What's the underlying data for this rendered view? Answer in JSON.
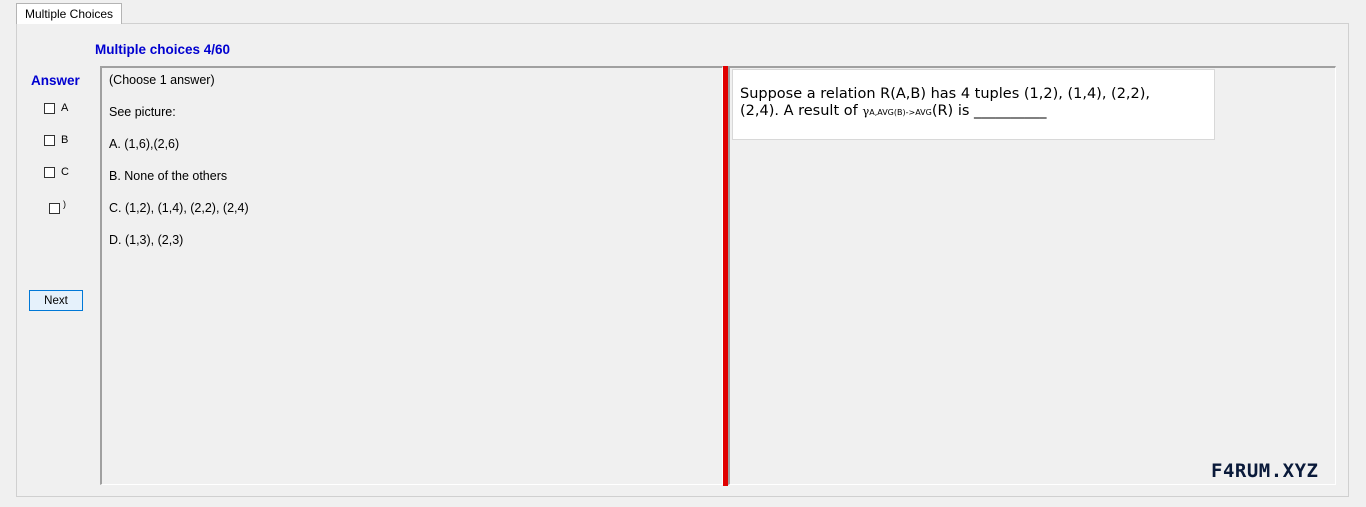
{
  "tab": {
    "label": "Multiple Choices"
  },
  "header": {
    "counter": "Multiple choices 4/60"
  },
  "answer": {
    "label": "Answer",
    "options": [
      {
        "letter": "A",
        "checked": false
      },
      {
        "letter": "B",
        "checked": false
      },
      {
        "letter": "C",
        "checked": false
      },
      {
        "letter": ")",
        "checked": false
      }
    ]
  },
  "next_button": {
    "label": "Next"
  },
  "question": {
    "instruction": "(Choose 1 answer)",
    "prompt": "See picture:",
    "choices": [
      "A.  (1,6),(2,6)",
      "B.  None of the others",
      "C.  (1,2), (1,4), (2,2), (2,4)",
      "D.  (1,3), (2,3)"
    ]
  },
  "picture": {
    "line1": "Suppose a relation R(A,B) has 4 tuples (1,2), (1,4), (2,2),",
    "line2_pre": "(2,4). A result of ",
    "gamma": "γ",
    "gamma_sub": "A,AVG(B)->AVG",
    "line2_post": "(R)  is __________"
  },
  "watermark": "F4RUM.XYZ",
  "colors": {
    "accent_blue": "#0000d0",
    "splitter_red": "#e00000",
    "button_border": "#0078d7"
  }
}
